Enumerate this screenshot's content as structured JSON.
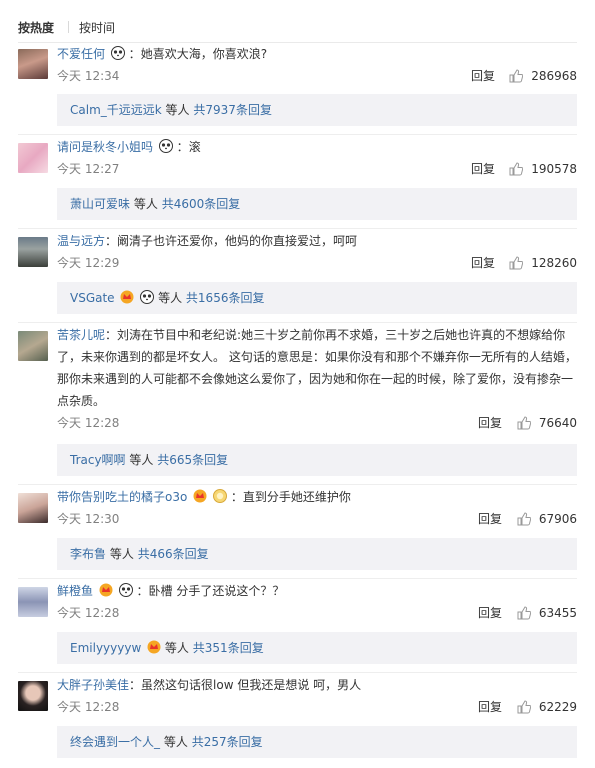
{
  "tabs": {
    "hot": "按热度",
    "time": "按时间"
  },
  "labels": {
    "reply": "回复",
    "and_others": "等人",
    "total_prefix": "共",
    "total_suffix": "条回复"
  },
  "comments": [
    {
      "user": "不爱任何",
      "sep": "：",
      "text": "她喜欢大海，你喜欢浪?",
      "time": "今天 12:34",
      "likes": "286968",
      "sub_user": "Calm_千远远远k",
      "sub_count": "7937"
    },
    {
      "user": "请问是秋冬小姐吗",
      "sep": "：",
      "text": "滚",
      "time": "今天 12:27",
      "likes": "190578",
      "sub_user": "萧山可爱味",
      "sub_count": "4600"
    },
    {
      "user": "温与远方",
      "sep": "：",
      "text": "阚清子也许还爱你，他妈的你直接爱过，呵呵",
      "time": "今天 12:29",
      "likes": "128260",
      "sub_user": "VSGate",
      "sub_count": "1656"
    },
    {
      "user": "苦茶儿呢",
      "sep": "：",
      "text": "刘涛在节目中和老纪说:她三十岁之前你再不求婚，三十岁之后她也许真的不想嫁给你了，未来你遇到的都是坏女人。  这句话的意思是：如果你没有和那个不嫌弃你一无所有的人结婚，那你未来遇到的人可能都不会像她这么爱你了，因为她和你在一起的时候，除了爱你，没有掺杂一点杂质。",
      "time": "今天 12:28",
      "likes": "76640",
      "sub_user": "Tracy啊啊",
      "sub_count": "665"
    },
    {
      "user": "带你告别吃土的橘子o3o",
      "sep": "：",
      "text": "直到分手她还维护你",
      "time": "今天 12:30",
      "likes": "67906",
      "sub_user": "李布鲁",
      "sub_count": "466"
    },
    {
      "user": "鲜橙鱼",
      "sep": "：",
      "text": "卧槽 分手了还说这个？？",
      "time": "今天 12:28",
      "likes": "63455",
      "sub_user": "Emilyyyyyw",
      "sub_count": "351"
    },
    {
      "user": "大胖子孙美佳",
      "sep": "：",
      "text": "虽然这句话很low  但我还是想说  呵，男人",
      "time": "今天 12:28",
      "likes": "62229",
      "sub_user": "终会遇到一个人_",
      "sub_count": "257"
    }
  ]
}
